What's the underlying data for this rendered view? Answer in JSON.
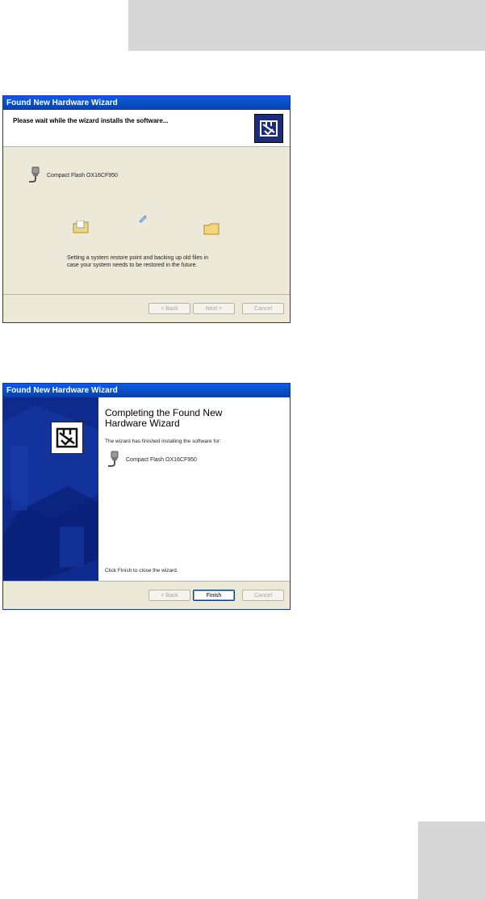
{
  "page": {
    "top_bar_color": "#d7d7d7",
    "corner_block_color": "#d7d7d7"
  },
  "window1": {
    "title": "Found New Hardware Wizard",
    "header_text": "Please wait while the wizard installs the software...",
    "device_name": "Compact Flash OX16CF950",
    "status_line1": "Setting a system restore point and backing up old files in",
    "status_line2": "case your system needs to be restored in the future.",
    "buttons": {
      "back": "< Back",
      "next": "Next >",
      "cancel": "Cancel"
    }
  },
  "window2": {
    "title": "Found New Hardware Wizard",
    "heading_line1": "Completing the Found New",
    "heading_line2": "Hardware Wizard",
    "subtitle": "The wizard has finished installing the software for:",
    "device_name": "Compact Flash OX16CF950",
    "close_hint": "Click Finish to close the wizard.",
    "buttons": {
      "back": "< Back",
      "finish": "Finish",
      "cancel": "Cancel"
    }
  },
  "icons": {
    "wizard": "hardware-wizard-icon",
    "device": "serial-connector-icon",
    "folder": "folder-icon",
    "document": "flying-document-icon"
  },
  "colors": {
    "titlebar": "#0a4fd0",
    "dialog_bg": "#ece9d8",
    "wizard_panel": "#0d2a8c"
  }
}
